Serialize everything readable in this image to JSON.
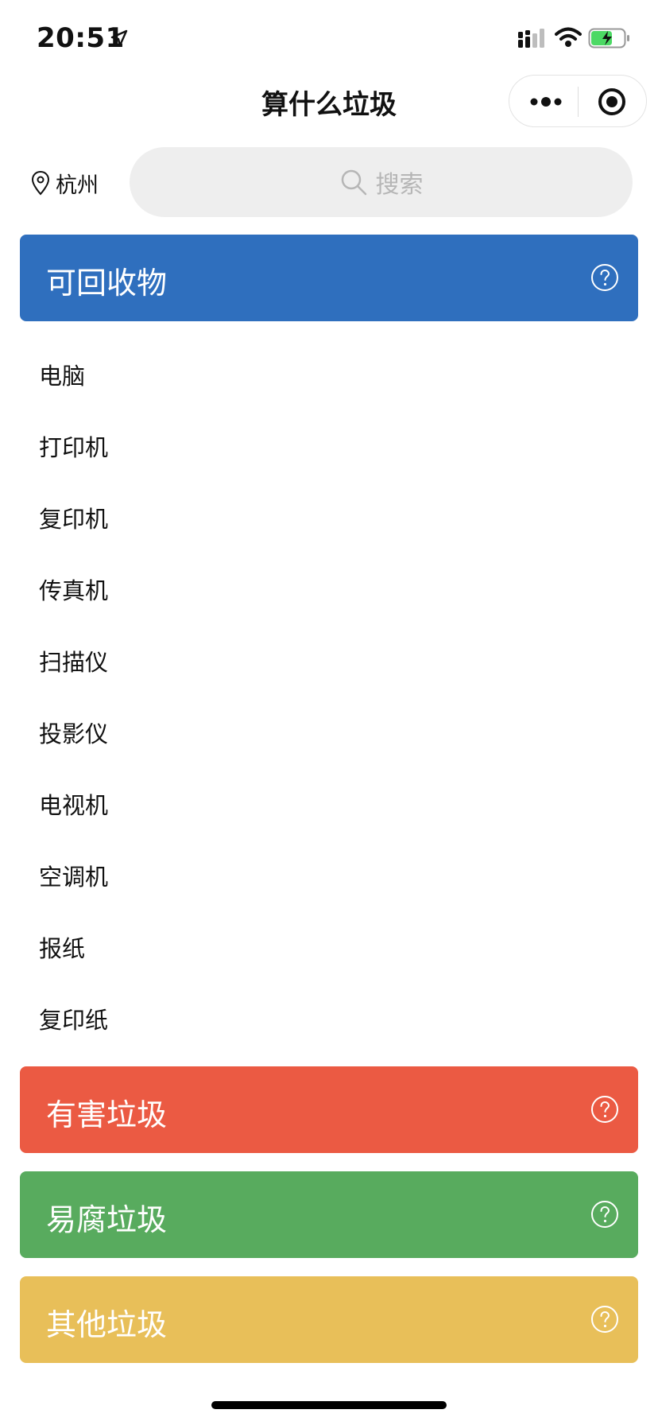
{
  "status_bar": {
    "time": "20:51",
    "battery_fraction": 0.65
  },
  "nav": {
    "title": "算什么垃圾",
    "more_icon": "more-dots-icon",
    "close_icon": "target-circle-icon"
  },
  "location": {
    "city": "杭州",
    "icon": "map-pin-icon"
  },
  "search": {
    "placeholder": "搜索",
    "icon": "search-icon"
  },
  "categories": [
    {
      "label": "可回收物",
      "color": "#2F6FBE",
      "expanded": true,
      "items": [
        "电脑",
        "打印机",
        "复印机",
        "传真机",
        "扫描仪",
        "投影仪",
        "电视机",
        "空调机",
        "报纸",
        "复印纸"
      ]
    },
    {
      "label": "有害垃圾",
      "color": "#EB5A43"
    },
    {
      "label": "易腐垃圾",
      "color": "#58AB5E"
    },
    {
      "label": "其他垃圾",
      "color": "#E8BF59"
    }
  ],
  "colors": {
    "search_bg": "#EEEEEE",
    "placeholder": "#B6B6B6",
    "battery_fill": "#4CD964"
  }
}
